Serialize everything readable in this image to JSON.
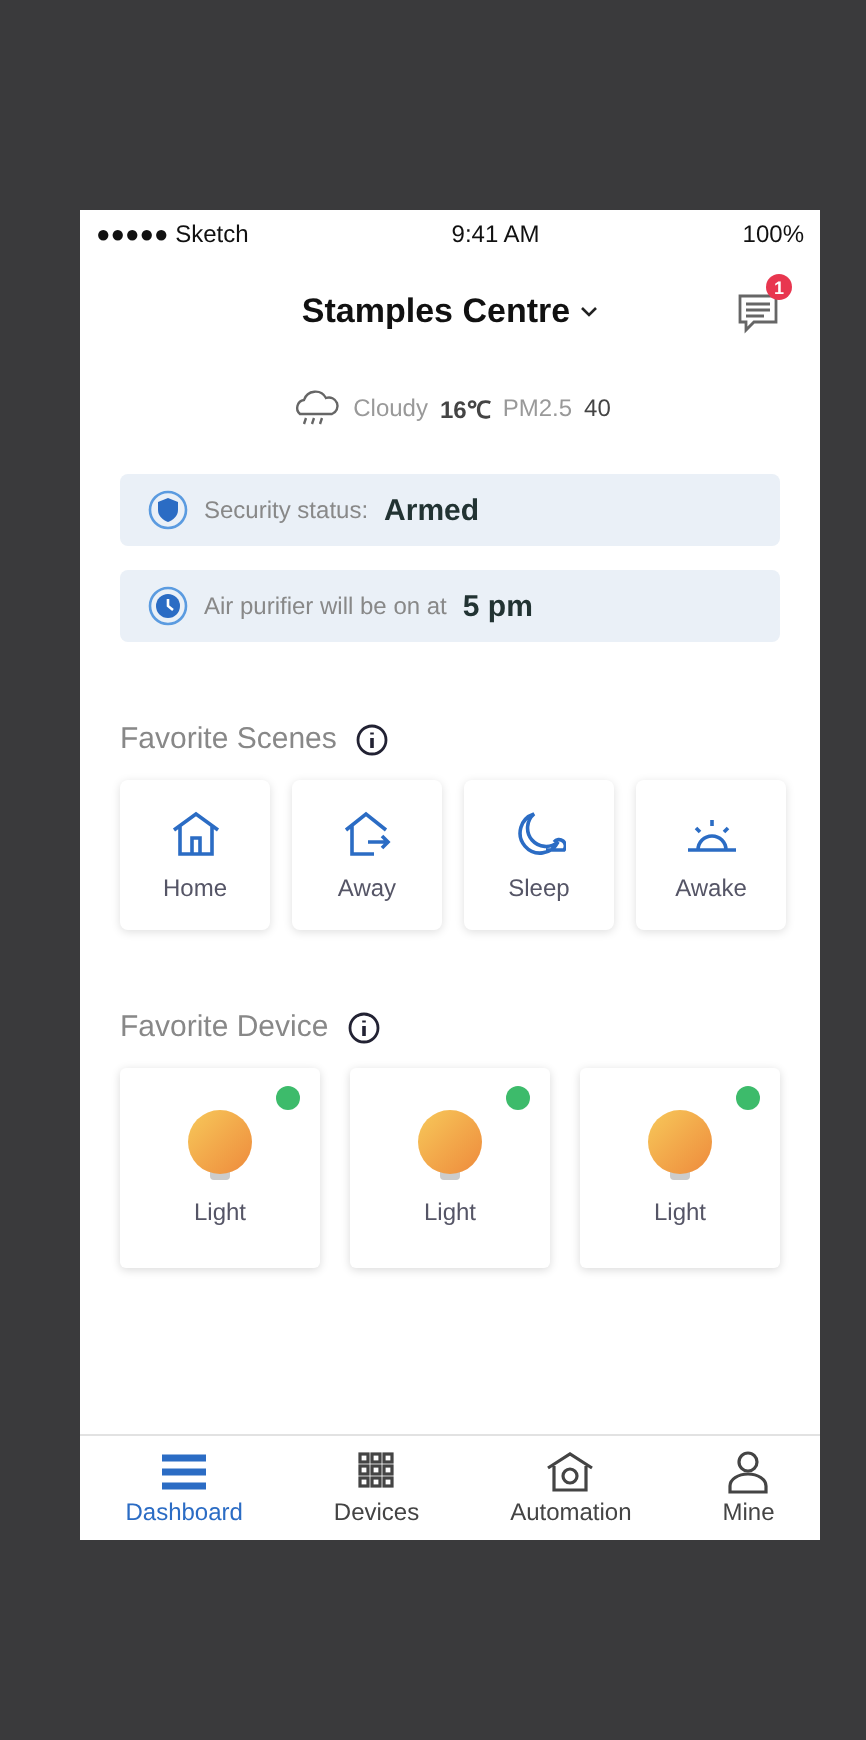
{
  "status_bar": {
    "carrier": "●●●●● Sketch",
    "time": "9:41 AM",
    "battery": "100%"
  },
  "header": {
    "title": "Stamples Centre",
    "notifications": "1"
  },
  "weather": {
    "condition": "Cloudy",
    "temperature": "16℃",
    "pm_label": "PM2.5",
    "pm_value": "40"
  },
  "status_cards": [
    {
      "kind": "security",
      "label": "Security status:",
      "value": "Armed"
    },
    {
      "kind": "schedule",
      "label": "Air purifier will be on at",
      "value": "5 pm"
    }
  ],
  "scenes": {
    "title": "Favorite Scenes",
    "items": [
      {
        "kind": "home",
        "label": "Home"
      },
      {
        "kind": "away",
        "label": "Away"
      },
      {
        "kind": "sleep",
        "label": "Sleep"
      },
      {
        "kind": "awake",
        "label": "Awake"
      }
    ]
  },
  "devices": {
    "title": "Favorite Device",
    "items": [
      {
        "label": "Light",
        "online": true
      },
      {
        "label": "Light",
        "online": true
      },
      {
        "label": "Light",
        "online": true
      }
    ]
  },
  "tabs": [
    {
      "kind": "dashboard",
      "label": "Dashboard",
      "selected": true
    },
    {
      "kind": "devices",
      "label": "Devices",
      "selected": false
    },
    {
      "kind": "automation",
      "label": "Automation",
      "selected": false
    },
    {
      "kind": "mine",
      "label": "Mine",
      "selected": false
    }
  ]
}
